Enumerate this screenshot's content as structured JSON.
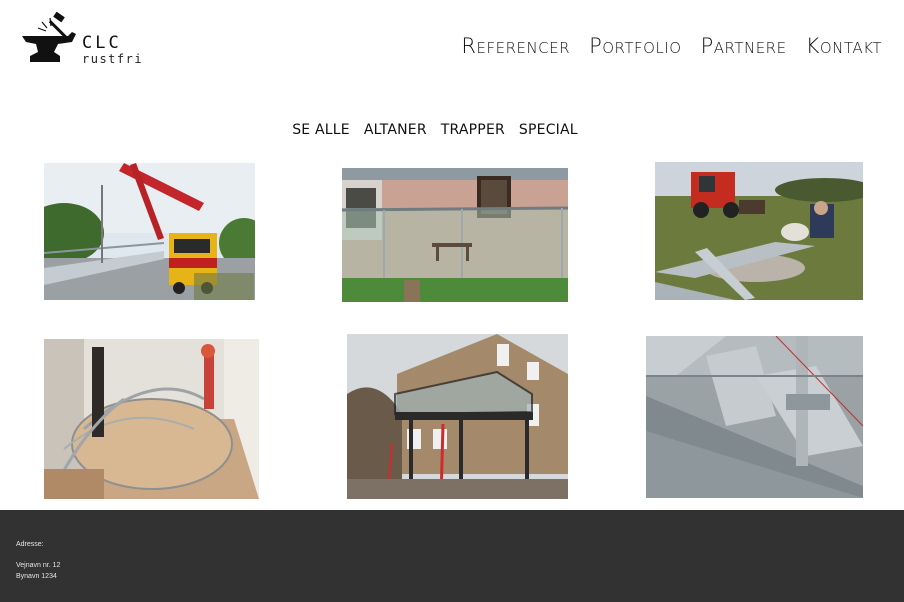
{
  "brand": {
    "name": "CLC",
    "subtitle": "rustfri"
  },
  "nav": {
    "items": [
      {
        "label": "Referencer"
      },
      {
        "label": "Portfolio"
      },
      {
        "label": "Partnere"
      },
      {
        "label": "Kontakt"
      }
    ]
  },
  "filters": {
    "items": [
      {
        "label": "SE ALLE"
      },
      {
        "label": "ALTANER"
      },
      {
        "label": "TRAPPER"
      },
      {
        "label": "SPECIAL"
      }
    ]
  },
  "gallery": {
    "photos": [
      {
        "subject": "crane-truck-bridge-photo"
      },
      {
        "subject": "glass-railing-house-photo"
      },
      {
        "subject": "steel-frame-field-photo"
      },
      {
        "subject": "spiral-staircase-photo"
      },
      {
        "subject": "balcony-house-photo"
      },
      {
        "subject": "steel-grating-stairs-photo"
      }
    ]
  },
  "footer": {
    "address_label": "Adresse:",
    "street": "Vejnavn  nr.  12",
    "city": "Bynavn  1234"
  },
  "colors": {
    "footer_bg": "#323232",
    "text": "#111111",
    "background": "#ffffff"
  }
}
